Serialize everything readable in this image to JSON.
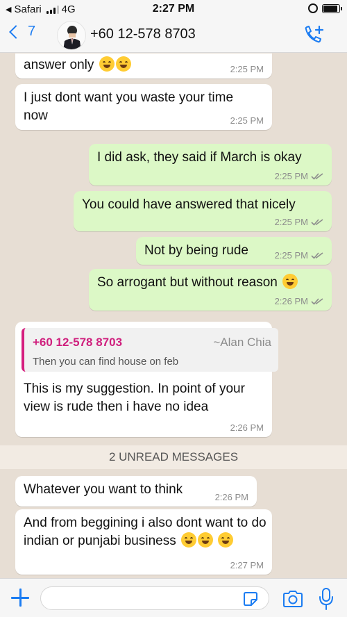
{
  "status_bar": {
    "back_app": "Safari",
    "network": "4G",
    "time": "2:27 PM",
    "signal_bars": 3,
    "battery_level": 0.9
  },
  "header": {
    "back_count": "7",
    "contact": "+60 12-578 8703",
    "icons": [
      "chevron-left-icon",
      "avatar",
      "add-call-icon"
    ]
  },
  "messages": [
    {
      "dir": "in",
      "text": "answer only",
      "emoji": [
        "hugging-face-emoji",
        "hugging-face-emoji"
      ],
      "time": "2:25 PM"
    },
    {
      "dir": "in",
      "text": "I just dont want you waste your time now",
      "time": "2:25 PM"
    },
    {
      "dir": "out",
      "text": "I did ask, they said if March is okay",
      "time": "2:25 PM",
      "status": "read"
    },
    {
      "dir": "out",
      "text": "You could have answered that nicely",
      "time": "2:25 PM",
      "status": "read"
    },
    {
      "dir": "out",
      "text": "Not by being rude",
      "time": "2:25 PM",
      "status": "read"
    },
    {
      "dir": "out",
      "text": "So arrogant but without reason",
      "emoji": [
        "grinning-sweat-emoji"
      ],
      "time": "2:26 PM",
      "status": "read"
    },
    {
      "dir": "in",
      "quote": {
        "name": "+60 12-578 8703",
        "alias": "~Alan Chia",
        "text": "Then you can find house on feb"
      },
      "text": "This is my suggestion. In point of your view is rude then i have no idea",
      "time": "2:26 PM"
    },
    {
      "dir": "in",
      "text": "Whatever you want to think",
      "time": "2:26 PM"
    },
    {
      "dir": "in",
      "text": "And from beggining i also dont want to do indian or punjabi business",
      "emoji": [
        "rofl-emoji",
        "rofl-emoji",
        "rofl-emoji"
      ],
      "time": "2:27 PM"
    }
  ],
  "unread_banner": "2 UNREAD MESSAGES",
  "input": {
    "placeholder": "",
    "value": ""
  },
  "colors": {
    "accent": "#1b7cf2",
    "outgoing": "#dcf8c6",
    "incoming": "#ffffff",
    "background": "#e7ded4",
    "quote_author": "#cf1f7d",
    "tick": "#8c8c8c"
  }
}
